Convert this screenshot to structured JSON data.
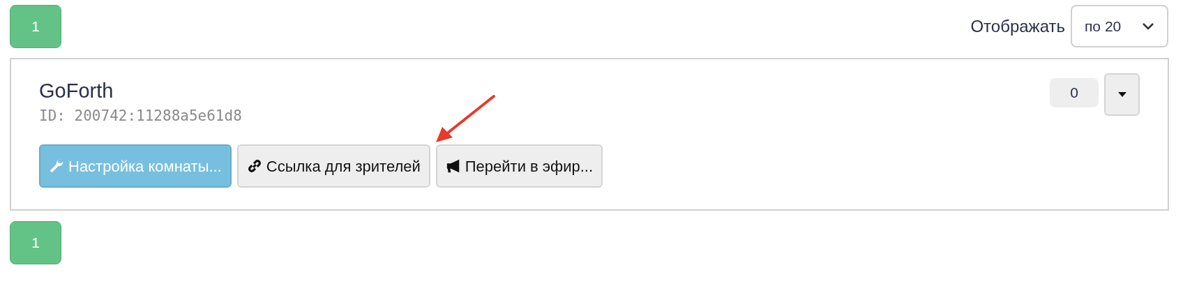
{
  "pagination_top": [
    {
      "label": "1",
      "selected": true
    }
  ],
  "page_size": {
    "label": "Отображать",
    "value": "по 20"
  },
  "room": {
    "name": "GoForth",
    "id": "ID: 200742:11288a5e61d8",
    "count": "0",
    "buttons": [
      {
        "kind": "primary",
        "label": "Настройка комнаты..."
      },
      {
        "kind": "default",
        "label": "Ссылка для зрителей"
      },
      {
        "kind": "default",
        "label": "Перейти в эфир..."
      }
    ]
  },
  "pagination_bottom": [
    {
      "label": "1",
      "selected": true
    }
  ]
}
